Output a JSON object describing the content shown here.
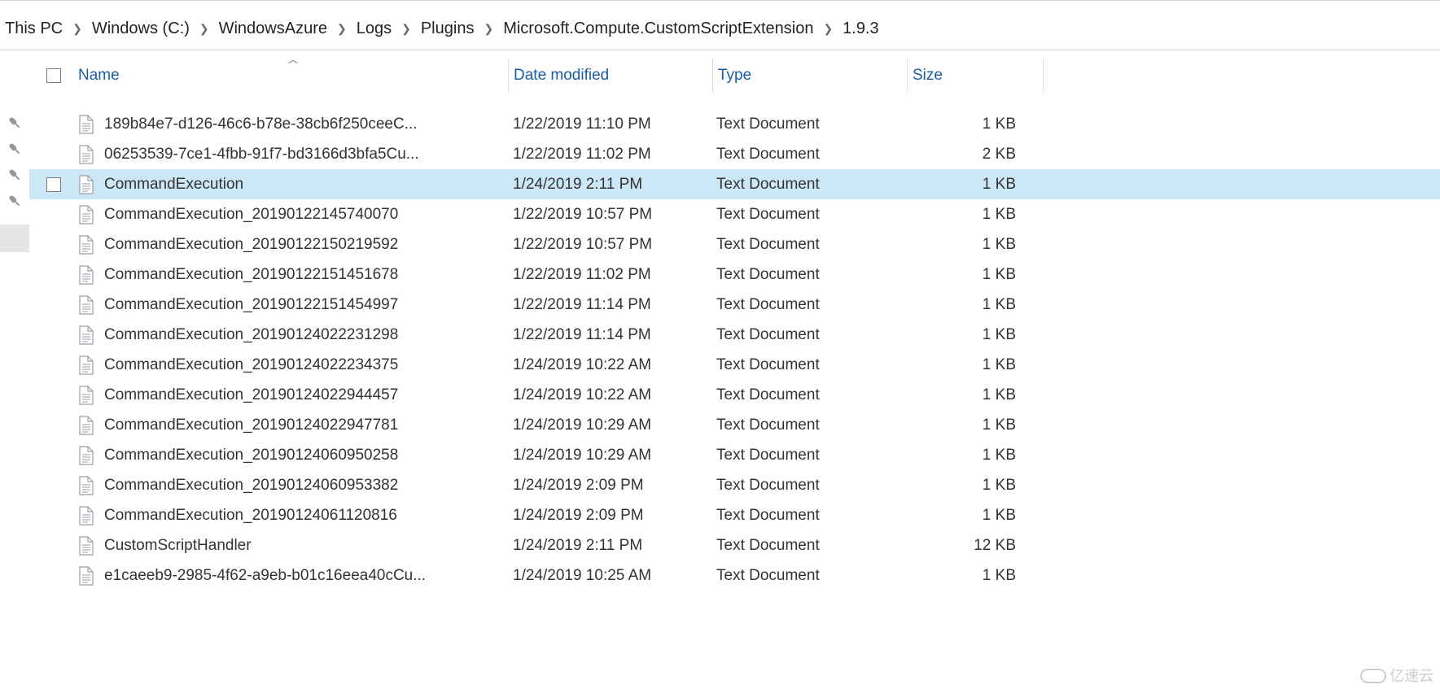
{
  "breadcrumb": [
    {
      "label": "This PC"
    },
    {
      "label": "Windows (C:)"
    },
    {
      "label": "WindowsAzure"
    },
    {
      "label": "Logs"
    },
    {
      "label": "Plugins"
    },
    {
      "label": "Microsoft.Compute.CustomScriptExtension"
    },
    {
      "label": "1.9.3"
    }
  ],
  "columns": {
    "name": "Name",
    "date": "Date modified",
    "type": "Type",
    "size": "Size"
  },
  "files": [
    {
      "name": "189b84e7-d126-46c6-b78e-38cb6f250ceeC...",
      "date": "1/22/2019 11:10 PM",
      "type": "Text Document",
      "size": "1 KB",
      "selected": false
    },
    {
      "name": "06253539-7ce1-4fbb-91f7-bd3166d3bfa5Cu...",
      "date": "1/22/2019 11:02 PM",
      "type": "Text Document",
      "size": "2 KB",
      "selected": false
    },
    {
      "name": "CommandExecution",
      "date": "1/24/2019 2:11 PM",
      "type": "Text Document",
      "size": "1 KB",
      "selected": true
    },
    {
      "name": "CommandExecution_20190122145740070",
      "date": "1/22/2019 10:57 PM",
      "type": "Text Document",
      "size": "1 KB",
      "selected": false
    },
    {
      "name": "CommandExecution_20190122150219592",
      "date": "1/22/2019 10:57 PM",
      "type": "Text Document",
      "size": "1 KB",
      "selected": false
    },
    {
      "name": "CommandExecution_20190122151451678",
      "date": "1/22/2019 11:02 PM",
      "type": "Text Document",
      "size": "1 KB",
      "selected": false
    },
    {
      "name": "CommandExecution_20190122151454997",
      "date": "1/22/2019 11:14 PM",
      "type": "Text Document",
      "size": "1 KB",
      "selected": false
    },
    {
      "name": "CommandExecution_20190124022231298",
      "date": "1/22/2019 11:14 PM",
      "type": "Text Document",
      "size": "1 KB",
      "selected": false
    },
    {
      "name": "CommandExecution_20190124022234375",
      "date": "1/24/2019 10:22 AM",
      "type": "Text Document",
      "size": "1 KB",
      "selected": false
    },
    {
      "name": "CommandExecution_20190124022944457",
      "date": "1/24/2019 10:22 AM",
      "type": "Text Document",
      "size": "1 KB",
      "selected": false
    },
    {
      "name": "CommandExecution_20190124022947781",
      "date": "1/24/2019 10:29 AM",
      "type": "Text Document",
      "size": "1 KB",
      "selected": false
    },
    {
      "name": "CommandExecution_20190124060950258",
      "date": "1/24/2019 10:29 AM",
      "type": "Text Document",
      "size": "1 KB",
      "selected": false
    },
    {
      "name": "CommandExecution_20190124060953382",
      "date": "1/24/2019 2:09 PM",
      "type": "Text Document",
      "size": "1 KB",
      "selected": false
    },
    {
      "name": "CommandExecution_20190124061120816",
      "date": "1/24/2019 2:09 PM",
      "type": "Text Document",
      "size": "1 KB",
      "selected": false
    },
    {
      "name": "CustomScriptHandler",
      "date": "1/24/2019 2:11 PM",
      "type": "Text Document",
      "size": "12 KB",
      "selected": false
    },
    {
      "name": "e1caeeb9-2985-4f62-a9eb-b01c16eea40cCu...",
      "date": "1/24/2019 10:25 AM",
      "type": "Text Document",
      "size": "1 KB",
      "selected": false
    }
  ],
  "quick_access_pins": 4,
  "watermark": "亿速云"
}
